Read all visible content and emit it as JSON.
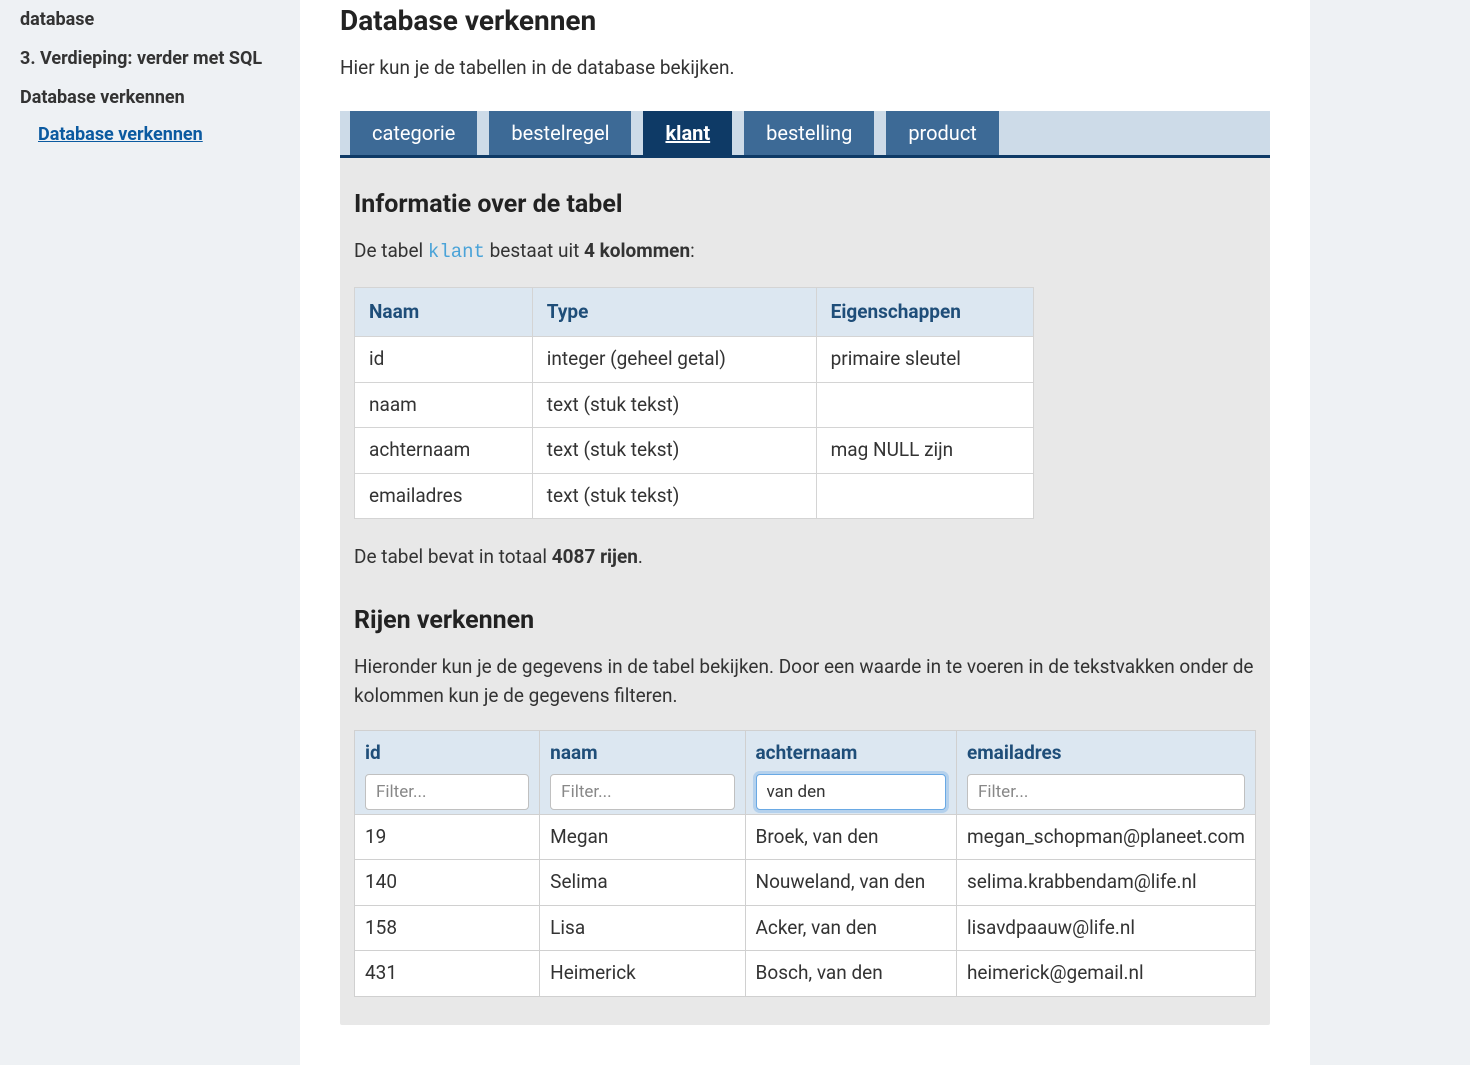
{
  "sidebar": {
    "items": [
      {
        "label": "database",
        "truncated": true
      },
      {
        "label": "3. Verdieping: verder met SQL"
      },
      {
        "label": "Database verkennen"
      }
    ],
    "sublink": "Database verkennen"
  },
  "page": {
    "title": "Database verkennen",
    "intro": "Hier kun je de tabellen in de database bekijken."
  },
  "tabs": [
    {
      "label": "categorie",
      "active": false
    },
    {
      "label": "bestelregel",
      "active": false
    },
    {
      "label": "klant",
      "active": true
    },
    {
      "label": "bestelling",
      "active": false
    },
    {
      "label": "product",
      "active": false
    }
  ],
  "info": {
    "heading": "Informatie over de tabel",
    "text_prefix": "De tabel ",
    "table_name": "klant",
    "text_mid": " bestaat uit ",
    "column_count": "4 kolommen",
    "text_suffix": ":",
    "rowcount_prefix": "De tabel bevat in totaal ",
    "rowcount": "4087 rijen",
    "rowcount_suffix": "."
  },
  "schema": {
    "headers": [
      "Naam",
      "Type",
      "Eigenschappen"
    ],
    "rows": [
      {
        "naam": "id",
        "type": "integer (geheel getal)",
        "eig": "primaire sleutel"
      },
      {
        "naam": "naam",
        "type": "text (stuk tekst)",
        "eig": ""
      },
      {
        "naam": "achternaam",
        "type": "text (stuk tekst)",
        "eig": "mag NULL zijn"
      },
      {
        "naam": "emailadres",
        "type": "text (stuk tekst)",
        "eig": ""
      }
    ]
  },
  "explore": {
    "heading": "Rijen verkennen",
    "intro": "Hieronder kun je de gegevens in de tabel bekijken. Door een waarde in te voeren in de tekstvakken onder de kolommen kun je de gegevens filteren.",
    "columns": [
      "id",
      "naam",
      "achternaam",
      "emailadres"
    ],
    "filter_placeholder": "Filter...",
    "filters": {
      "id": "",
      "naam": "",
      "achternaam": "van den",
      "emailadres": ""
    },
    "rows": [
      {
        "id": "19",
        "naam": "Megan",
        "achternaam": "Broek, van den",
        "emailadres": "megan_schopman@planeet.com"
      },
      {
        "id": "140",
        "naam": "Selima",
        "achternaam": "Nouweland, van den",
        "emailadres": "selima.krabbendam@life.nl"
      },
      {
        "id": "158",
        "naam": "Lisa",
        "achternaam": "Acker, van den",
        "emailadres": "lisavdpaauw@life.nl"
      },
      {
        "id": "431",
        "naam": "Heimerick",
        "achternaam": "Bosch, van den",
        "emailadres": "heimerick@gemail.nl"
      }
    ]
  }
}
